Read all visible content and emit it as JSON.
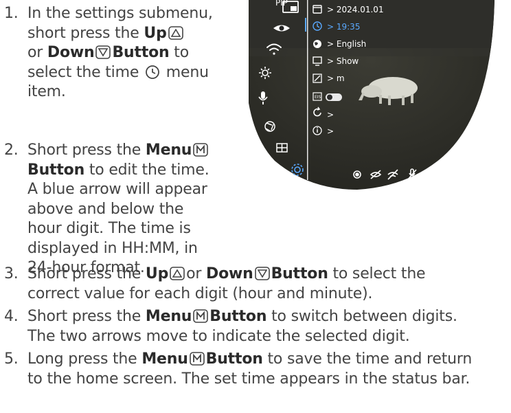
{
  "steps": [
    {
      "num": "1.",
      "lines": [
        [
          {
            "t": "In the settings submenu,"
          }
        ],
        [
          {
            "t": "short press the "
          },
          {
            "b": "Up"
          },
          {
            "icon": "up-triangle-button-icon"
          }
        ],
        [
          {
            "t": "or "
          },
          {
            "b": "Down"
          },
          {
            "icon": "down-triangle-button-icon"
          },
          {
            "b": "Button"
          },
          {
            "t": " to"
          }
        ],
        [
          {
            "t": "select the time "
          },
          {
            "icon": "clock-icon"
          },
          {
            "t": " menu"
          }
        ],
        [
          {
            "t": "item."
          }
        ]
      ]
    },
    {
      "num": "2.",
      "lines": [
        [
          {
            "t": "Short press the "
          },
          {
            "b": "Menu"
          },
          {
            "icon": "m-button-icon"
          }
        ],
        [
          {
            "b": "Button"
          },
          {
            "t": " to edit the time."
          }
        ],
        [
          {
            "t": "A blue arrow will appear"
          }
        ],
        [
          {
            "t": "above and below the"
          }
        ],
        [
          {
            "t": "hour digit. The time is"
          }
        ],
        [
          {
            "t": "displayed in HH:MM, in"
          }
        ],
        [
          {
            "t": "24-hour format."
          }
        ]
      ]
    },
    {
      "num": "3.",
      "lines": [
        [
          {
            "t": "Short press the "
          },
          {
            "b": "Up"
          },
          {
            "icon": "up-triangle-button-icon"
          },
          {
            "t": "or "
          },
          {
            "b": "Down"
          },
          {
            "icon": "down-triangle-button-icon"
          },
          {
            "b": "Button"
          },
          {
            "t": " to select the"
          }
        ],
        [
          {
            "t": "correct value for each digit (hour and minute)."
          }
        ]
      ]
    },
    {
      "num": "4.",
      "lines": [
        [
          {
            "t": "Short press the "
          },
          {
            "b": "Menu"
          },
          {
            "icon": "m-button-icon"
          },
          {
            "b": "Button"
          },
          {
            "t": " to switch between digits."
          }
        ],
        [
          {
            "t": "The two arrows move to indicate the selected digit."
          }
        ]
      ]
    },
    {
      "num": "5.",
      "lines": [
        [
          {
            "t": "Long press the "
          },
          {
            "b": "Menu"
          },
          {
            "icon": "m-button-icon"
          },
          {
            "b": "Button"
          },
          {
            "t": " to save the time and return"
          }
        ],
        [
          {
            "t": "to the home screen. The set time appears in the status bar."
          }
        ]
      ]
    }
  ],
  "viewfinder": {
    "pip_label": "PIP",
    "menu_values": [
      {
        "icon": "calendar-icon",
        "value": "> 2024.01.01",
        "selected": false
      },
      {
        "icon": "clock-icon",
        "value": "> 19:35",
        "selected": true
      },
      {
        "icon": "globe-icon",
        "value": "> English",
        "selected": false
      },
      {
        "icon": "display-icon",
        "value": "> Show",
        "selected": false
      },
      {
        "icon": "ruler-icon",
        "value": "> m",
        "selected": false
      },
      {
        "icon": "eis-icon",
        "value": "",
        "selected": false
      },
      {
        "icon": "reset-icon",
        "value": ">",
        "selected": false
      },
      {
        "icon": "info-icon",
        "value": ">",
        "selected": false
      }
    ],
    "eis_label": "EIS",
    "accent_color": "#5aa9ff"
  }
}
